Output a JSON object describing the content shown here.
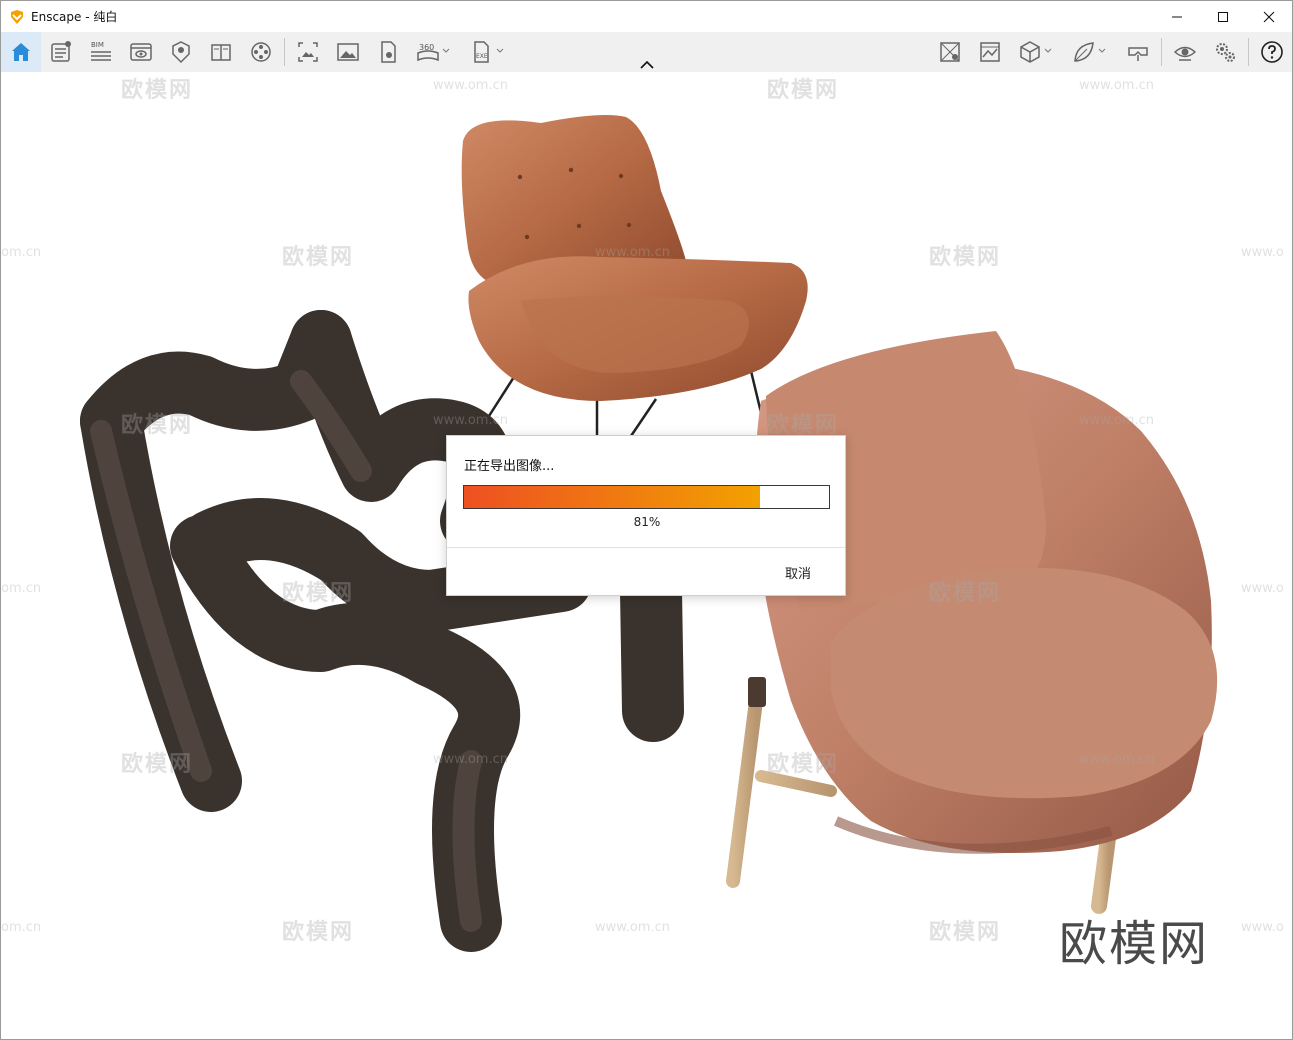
{
  "window": {
    "title": "Enscape - 纯白",
    "accent_color": "#f5a100"
  },
  "toolbar": {
    "left_icons": [
      "home-icon",
      "document-settings-icon",
      "bim-icon",
      "view-icon",
      "location-icon",
      "book-icon",
      "film-reel-icon",
      "image-crop-icon",
      "picture-icon",
      "file-image-icon",
      "panorama-360-icon",
      "export-exe-icon"
    ],
    "right_icons": [
      "texture-icon",
      "material-icon",
      "cube-icon",
      "leaf-icon",
      "vr-headset-icon",
      "eye-icon",
      "settings-gears-icon",
      "help-icon"
    ],
    "bim_label": "BIM",
    "pano_label": "360",
    "exe_label": "EXE"
  },
  "watermarks": {
    "brand": "欧模网",
    "url": "www.om.cn",
    "url_cut": "om.cn",
    "url_cut_right": "www.o",
    "logo": "欧模网"
  },
  "dialog": {
    "title": "正在导出图像...",
    "progress_percent": 81,
    "progress_label": "81%",
    "progress_colors": [
      "#ee5022",
      "#f2a100"
    ],
    "cancel_label": "取消"
  }
}
